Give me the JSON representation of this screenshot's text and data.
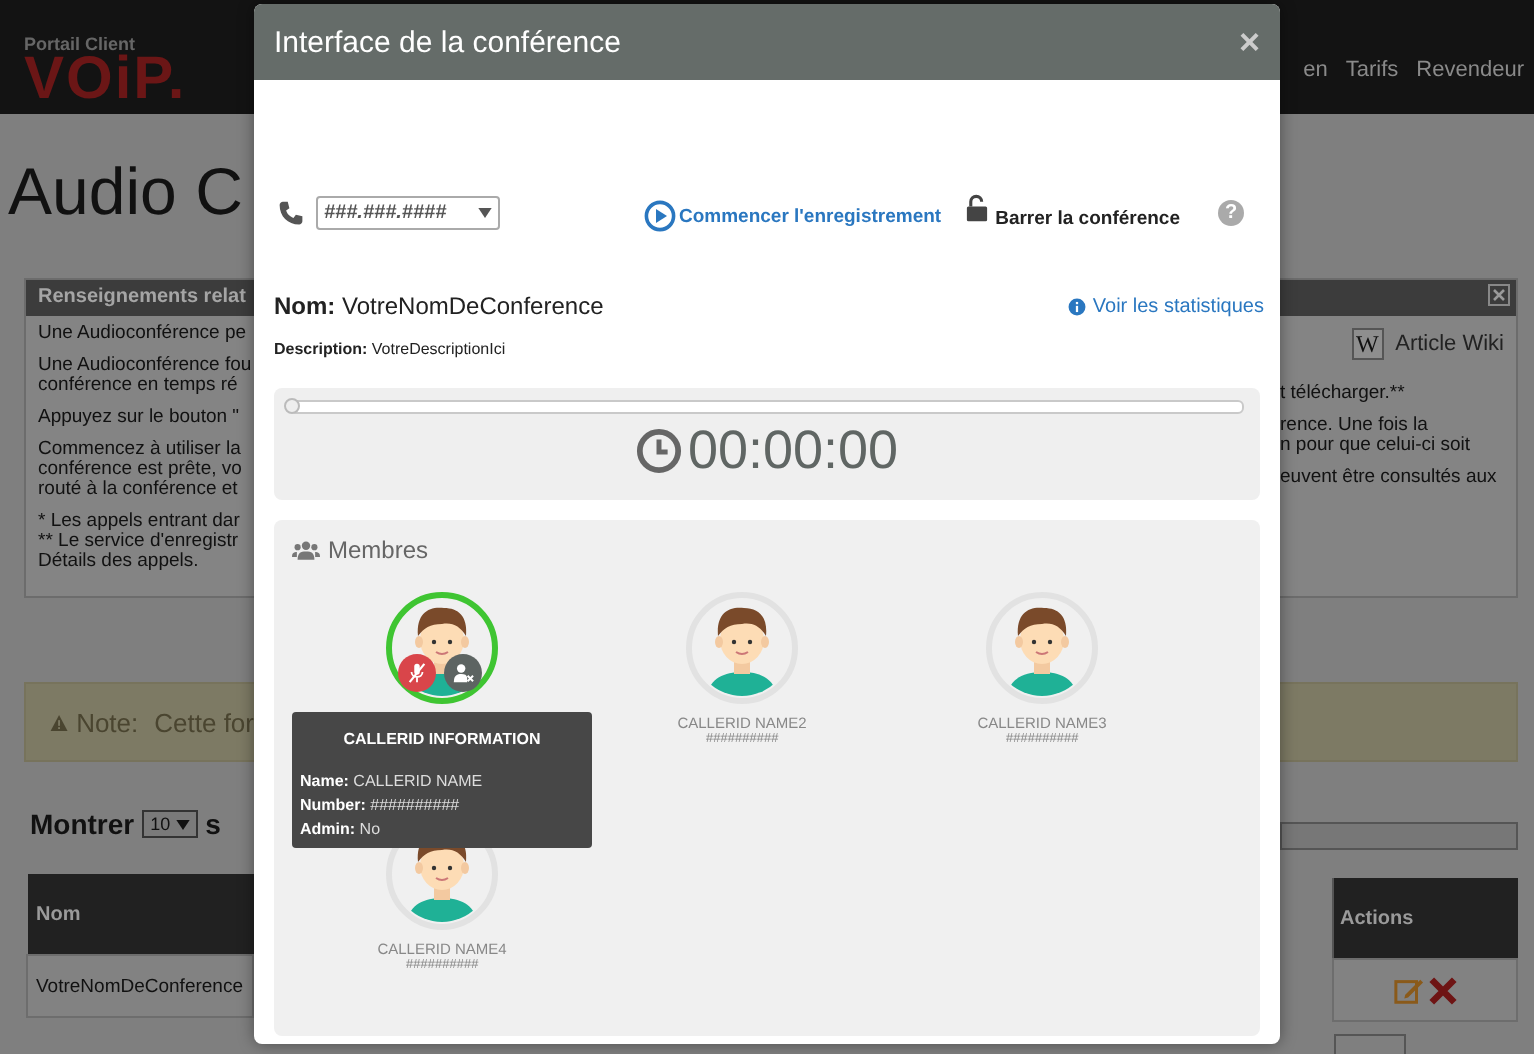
{
  "background_page": {
    "header": {
      "caption": "Portail Client",
      "logo": "VOiP.",
      "nav": [
        "en",
        "Tarifs",
        "Revendeur"
      ]
    },
    "title": "Audio C",
    "info_panel": {
      "title": "Renseignements relat",
      "left_paragraphs": [
        [
          "Une Audioconférence pe"
        ],
        [
          "Une Audioconférence fou",
          "conférence en temps ré"
        ],
        [
          "Appuyez sur le bouton \""
        ],
        [
          "Commencez à utiliser la",
          "conférence est prête, vo",
          "routé à la conférence et"
        ],
        [
          "* Les appels entrant dar",
          "** Le service d'enregistr",
          "Détails des appels."
        ]
      ],
      "wiki_icon": "W",
      "wiki_link": "Article Wiki",
      "right_paragraphs": [
        [
          "t télécharger.**"
        ],
        [
          "rence. Une fois la",
          "n pour que celui-ci soit"
        ],
        [
          "euvent être consultés aux"
        ]
      ]
    },
    "note": {
      "label": "Note:",
      "text": "Cette for"
    },
    "page_size": {
      "label": "Montrer",
      "value": "10",
      "after": "s"
    },
    "table": {
      "columns": [
        "Nom",
        "Actions"
      ],
      "rows": [
        {
          "name": "VotreNomDeConference"
        }
      ]
    }
  },
  "dialog": {
    "title": "Interface de la conférence",
    "close": "×",
    "phone_select": {
      "value": "###.###.####"
    },
    "record_link": "Commencer l'enregistrement",
    "lock_label": "Barrer la conférence",
    "help": "?",
    "name_label": "Nom:",
    "name": "VotreNomDeConference",
    "stats_link": "Voir les statistiques",
    "description_label": "Description:",
    "description": "VotreDescriptionIci",
    "progress": {
      "level": 0
    },
    "timer": "00:00:00",
    "members_title": "Membres",
    "members": [
      {
        "selected": true
      },
      {
        "name": "CALLERID NAME2",
        "number": "##########",
        "selected": false
      },
      {
        "name": "CALLERID NAME3",
        "number": "##########",
        "selected": false
      },
      {
        "name": "CALLERID NAME4",
        "number": "##########",
        "selected": false
      }
    ],
    "tooltip": {
      "title": "CALLERID INFORMATION",
      "fields": [
        {
          "label": "Name:",
          "value": "CALLERID NAME"
        },
        {
          "label": "Number:",
          "value": "##########"
        },
        {
          "label": "Admin:",
          "value": "No"
        }
      ]
    }
  }
}
